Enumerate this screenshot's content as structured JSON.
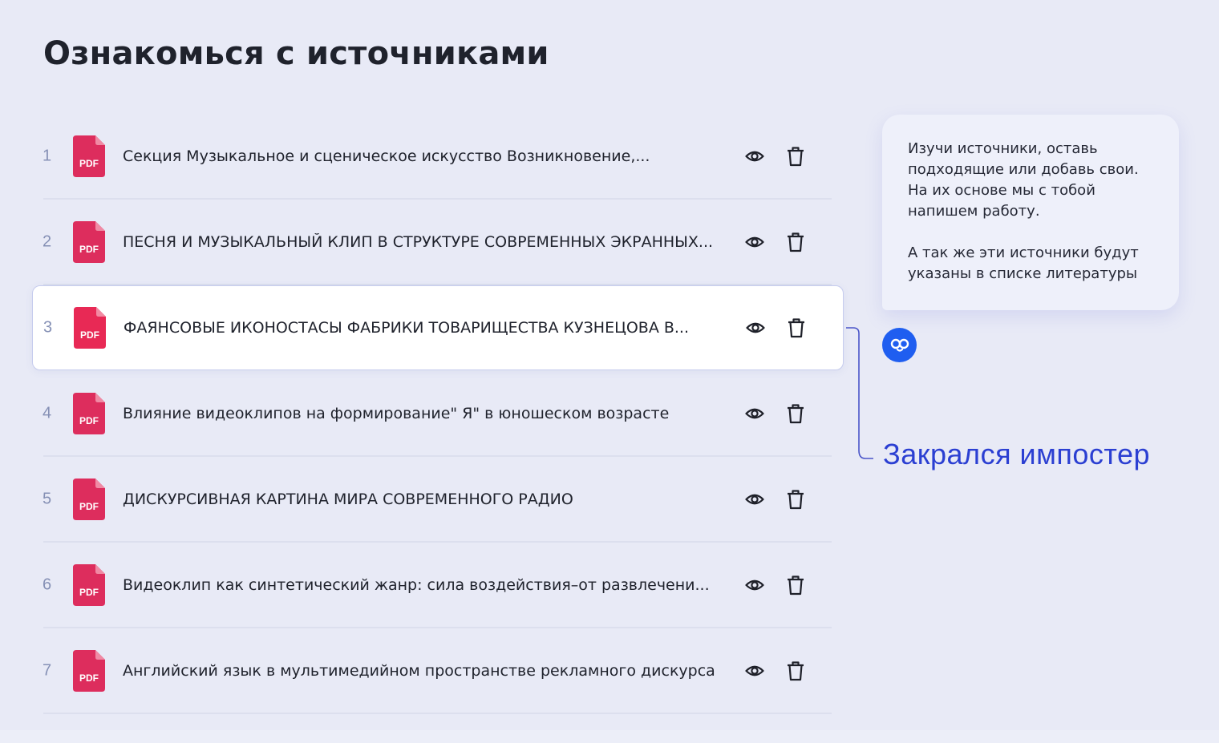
{
  "header": {
    "title": "Ознакомься с источниками"
  },
  "sources": [
    {
      "num": "1",
      "badge": "PDF",
      "title": "Секция Музыкальное и сценическое искусство Возникновение,..."
    },
    {
      "num": "2",
      "badge": "PDF",
      "title": "ПЕСНЯ И МУЗЫКАЛЬНЫЙ КЛИП В СТРУКТУРЕ СОВРЕМЕННЫХ ЭКРАННЫХ..."
    },
    {
      "num": "3",
      "badge": "PDF",
      "title": "ФАЯНСОВЫЕ ИКОНОСТАСЫ ФАБРИКИ ТОВАРИЩЕСТВА КУЗНЕЦОВА В..."
    },
    {
      "num": "4",
      "badge": "PDF",
      "title": "Влияние видеоклипов на формирование\" Я\" в юношеском возрасте"
    },
    {
      "num": "5",
      "badge": "PDF",
      "title": "ДИСКУРСИВНАЯ КАРТИНА МИРА СОВРЕМЕННОГО РАДИО"
    },
    {
      "num": "6",
      "badge": "PDF",
      "title": "Видеоклип как синтетический жанр: сила воздействия–от развлечени..."
    },
    {
      "num": "7",
      "badge": "PDF",
      "title": "Английский язык в мультимедийном пространстве рекламного дискурса"
    }
  ],
  "assistant": {
    "tip_line1": "Изучи источники, оставь подходящие или добавь свои. На их основе мы с тобой напишем работу.",
    "tip_line2": "А так же эти источники будут указаны в списке литературы"
  },
  "annotation": {
    "text": "Закрался импостер"
  },
  "colors": {
    "background": "#e8eaf6",
    "pdf_badge": "#e0245e",
    "annotation": "#2b3fd2",
    "avatar": "#1f5ef0"
  }
}
